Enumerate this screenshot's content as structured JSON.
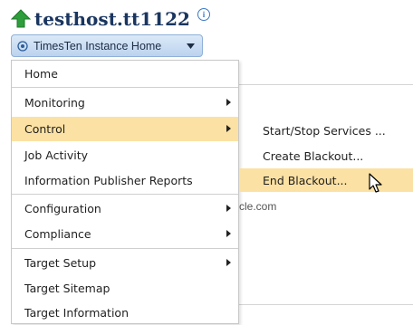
{
  "header": {
    "title": "testhost.tt1122",
    "info_icon": "info-icon",
    "up_icon": "up-arrow-icon"
  },
  "target_menu": {
    "label": "TimesTen Instance Home",
    "icon": "target-icon",
    "caret": "chevron-down-icon"
  },
  "background": {
    "partial_text": "cle.com"
  },
  "menu": {
    "items": [
      {
        "label": "Home",
        "has_submenu": false
      },
      {
        "label": "Monitoring",
        "has_submenu": true
      },
      {
        "label": "Control",
        "has_submenu": true,
        "active": true
      },
      {
        "label": "Job Activity",
        "has_submenu": false
      },
      {
        "label": "Information Publisher Reports",
        "has_submenu": false
      },
      {
        "label": "Configuration",
        "has_submenu": true
      },
      {
        "label": "Compliance",
        "has_submenu": true
      },
      {
        "label": "Target Setup",
        "has_submenu": true
      },
      {
        "label": "Target Sitemap",
        "has_submenu": false
      },
      {
        "label": "Target Information",
        "has_submenu": false
      }
    ]
  },
  "submenu": {
    "items": [
      {
        "label": "Start/Stop Services ..."
      },
      {
        "label": "Create Blackout..."
      },
      {
        "label": "End Blackout...",
        "active": true
      }
    ]
  },
  "colors": {
    "highlight": "#fbe1a3",
    "title": "#1a3660",
    "button_border": "#8fb0d8"
  }
}
